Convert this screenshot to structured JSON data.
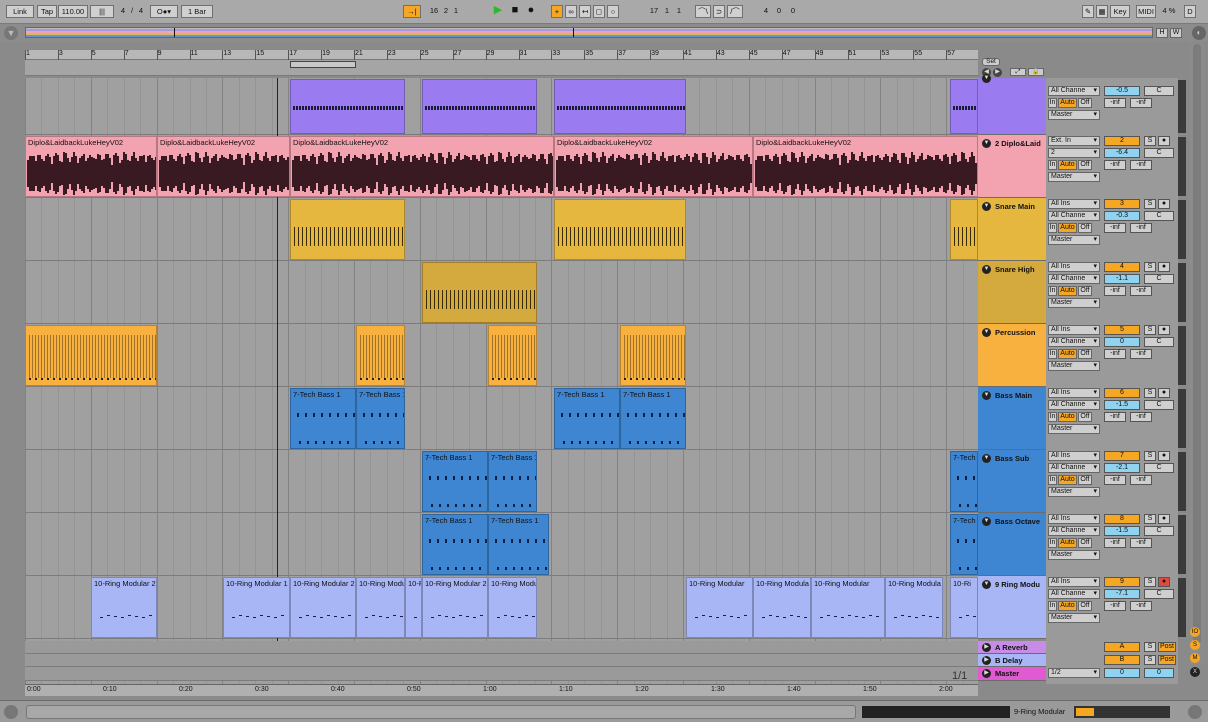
{
  "toolbar": {
    "link": "Link",
    "tap": "Tap",
    "tempo": "110.00",
    "signature_num": "4",
    "signature_den": "4",
    "quantize": "1 Bar",
    "song_position": [
      "16",
      "2",
      "1"
    ],
    "loop_start": [
      "17",
      "1",
      "1"
    ],
    "loop_length": [
      "4",
      "0",
      "0"
    ],
    "key_label": "Key",
    "midi_label": "MIDI",
    "cpu": "4 %",
    "d_label": "D"
  },
  "overview": {
    "h": "H",
    "w": "W"
  },
  "ruler": {
    "bars": [
      "1",
      "3",
      "5",
      "7",
      "9",
      "11",
      "13",
      "15",
      "17",
      "19",
      "21",
      "23",
      "25",
      "27",
      "29",
      "31",
      "33",
      "35",
      "37",
      "39",
      "41",
      "43",
      "45",
      "47",
      "49",
      "51",
      "53",
      "55",
      "57"
    ]
  },
  "set_label": "Set",
  "timebar": {
    "labels": [
      "0:00",
      "0:10",
      "0:20",
      "0:30",
      "0:40",
      "0:50",
      "1:00",
      "1:10",
      "1:20",
      "1:30",
      "1:40",
      "1:50",
      "2:00"
    ]
  },
  "page_indicator": "1/1",
  "tracks": [
    {
      "name": "",
      "color": "#9b7cf0",
      "input": "",
      "channel": "All Channe",
      "monitor": [
        "In",
        "Auto",
        "Off"
      ],
      "output": "Master",
      "number": "",
      "volume": "-0.5",
      "pan": "C",
      "send_a": "-inf",
      "send_b": "-inf"
    },
    {
      "name": "2 Diplo&Laid",
      "color": "#f3a2b0",
      "input": "Ext. In",
      "channel": "2",
      "monitor": [
        "In",
        "Auto",
        "Off"
      ],
      "output": "Master",
      "number": "2",
      "volume": "-6.4",
      "pan": "C",
      "send_a": "-inf",
      "send_b": "-inf"
    },
    {
      "name": "Snare Main",
      "color": "#e6b73f",
      "input": "All Ins",
      "channel": "All Channe",
      "monitor": [
        "In",
        "Auto",
        "Off"
      ],
      "output": "Master",
      "number": "3",
      "volume": "-0.3",
      "pan": "C",
      "send_a": "-inf",
      "send_b": "-inf"
    },
    {
      "name": "Snare High",
      "color": "#d4aa3e",
      "input": "All Ins",
      "channel": "All Channe",
      "monitor": [
        "In",
        "Auto",
        "Off"
      ],
      "output": "Master",
      "number": "4",
      "volume": "-1.1",
      "pan": "C",
      "send_a": "-inf",
      "send_b": "-inf"
    },
    {
      "name": "Percussion",
      "color": "#f8b13f",
      "input": "All Ins",
      "channel": "All Channe",
      "monitor": [
        "In",
        "Auto",
        "Off"
      ],
      "output": "Master",
      "number": "5",
      "volume": "0",
      "pan": "C",
      "send_a": "-inf",
      "send_b": "-inf"
    },
    {
      "name": "Bass Main",
      "color": "#3f86d2",
      "input": "All Ins",
      "channel": "All Channe",
      "monitor": [
        "In",
        "Auto",
        "Off"
      ],
      "output": "Master",
      "number": "6",
      "volume": "-1.5",
      "pan": "C",
      "send_a": "-inf",
      "send_b": "-inf"
    },
    {
      "name": "Bass Sub",
      "color": "#3f86d2",
      "input": "All Ins",
      "channel": "All Channe",
      "monitor": [
        "In",
        "Auto",
        "Off"
      ],
      "output": "Master",
      "number": "7",
      "volume": "-2.1",
      "pan": "C",
      "send_a": "-inf",
      "send_b": "-inf"
    },
    {
      "name": "Bass Octave",
      "color": "#3f86d2",
      "input": "All Ins",
      "channel": "All Channe",
      "monitor": [
        "In",
        "Auto",
        "Off"
      ],
      "output": "Master",
      "number": "8",
      "volume": "-1.5",
      "pan": "C",
      "send_a": "-inf",
      "send_b": "-inf"
    },
    {
      "name": "9 Ring Modu",
      "color": "#a9b6f5",
      "input": "All Ins",
      "channel": "All Channe",
      "monitor": [
        "In",
        "Auto",
        "Off"
      ],
      "output": "Master",
      "number": "9",
      "volume": "-7.1",
      "pan": "C",
      "send_a": "-inf",
      "send_b": "-inf"
    }
  ],
  "returns": [
    {
      "name": "A Reverb",
      "color": "#c78ce6",
      "number": "A",
      "post": "Post"
    },
    {
      "name": "B Delay",
      "color": "#a9b6f5",
      "number": "B",
      "post": "Post"
    }
  ],
  "master": {
    "name": "Master",
    "color": "#e05bd2",
    "output": "1/2",
    "volume": "0",
    "pan": "0"
  },
  "clips": {
    "diplo": "Diplo&LaidbackLukeHeyV02",
    "tech": "7-Tech Bass 1",
    "ring": "10-Ring Modular 2",
    "ring1": "10-Ring Modular 1",
    "ring_short": "10-Ring Modu",
    "ring_r": "10-R",
    "ring_mod": "10-Ring Modula",
    "ring_m": "10-Ring Modular",
    "ring_9": "10-Ri",
    "tech_short": "7-Tech"
  },
  "status": {
    "device": "9-Ring Modular"
  }
}
